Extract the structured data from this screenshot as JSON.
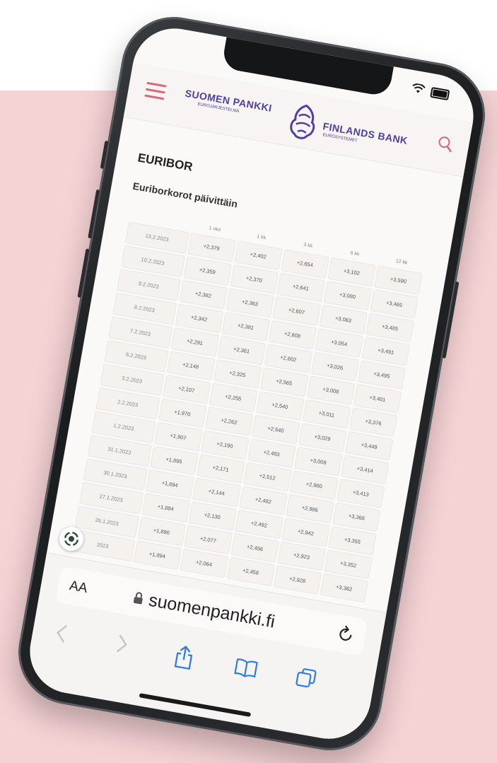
{
  "colors": {
    "background": "#f5d2d4",
    "brand": "#4f3fa0",
    "menu": "#d86a78",
    "link_blue": "#2f7de1"
  },
  "header": {
    "logo_fi": "SUOMEN PANKKI",
    "logo_fi_sub": "EUROJÄRJESTELMÄ",
    "logo_sv": "FINLANDS BANK",
    "logo_sv_sub": "EUROSYSTEMET"
  },
  "page": {
    "title": "EURIBOR",
    "subtitle": "Euriborkorot päivittäin"
  },
  "table": {
    "columns": [
      "",
      "1 vko",
      "1 kk",
      "3 kk",
      "6 kk",
      "12 kk"
    ],
    "rows": [
      [
        "13.2.2023",
        "+2,379",
        "+2,402",
        "+2,654",
        "+3,102",
        "+3,590"
      ],
      [
        "10.2.2023",
        "+2,359",
        "+2,370",
        "+2,641",
        "+3,080",
        "+3,465"
      ],
      [
        "9.2.2023",
        "+2,382",
        "+2,363",
        "+2,607",
        "+3,063",
        "+3,485"
      ],
      [
        "8.2.2023",
        "+2,342",
        "+2,381",
        "+2,608",
        "+3,054",
        "+3,491"
      ],
      [
        "7.2.2023",
        "+2,291",
        "+2,361",
        "+2,602",
        "+3,026",
        "+3,495"
      ],
      [
        "6.2.2023",
        "+2,148",
        "+2,325",
        "+2,565",
        "+3,008",
        "+3,401"
      ],
      [
        "3.2.2023",
        "+2,107",
        "+2,255",
        "+2,540",
        "+3,011",
        "+3,376"
      ],
      [
        "2.2.2023",
        "+1,970",
        "+2,262",
        "+2,540",
        "+3,029",
        "+3,449"
      ],
      [
        "1.2.2023",
        "+1,907",
        "+2,190",
        "+2,483",
        "+3,009",
        "+3,414"
      ],
      [
        "31.1.2023",
        "+1,895",
        "+2,171",
        "+2,512",
        "+2,980",
        "+3,413"
      ],
      [
        "30.1.2023",
        "+1,894",
        "+2,144",
        "+2,482",
        "+2,986",
        "+3,368"
      ],
      [
        "27.1.2023",
        "+1,884",
        "+2,130",
        "+2,492",
        "+2,942",
        "+3,355"
      ],
      [
        "26.1.2023",
        "+1,890",
        "+2,077",
        "+2,456",
        "+2,923",
        "+3,352"
      ],
      [
        "2023",
        "+1,894",
        "+2,064",
        "+2,458",
        "+2,928",
        "+3,362"
      ]
    ]
  },
  "browser": {
    "text_size_label": "AA",
    "url": "suomenpankki.fi",
    "icons": [
      "back-icon",
      "forward-icon",
      "share-icon",
      "bookmarks-icon",
      "tabs-icon",
      "reload-icon",
      "lock-icon"
    ]
  }
}
